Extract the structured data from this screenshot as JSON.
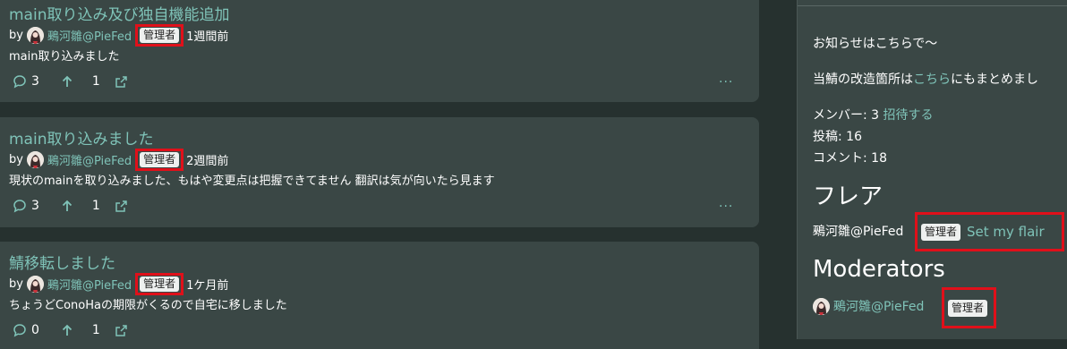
{
  "posts": [
    {
      "title": "main取り込み及び独自機能追加",
      "by": "by",
      "author": "鵐河雛@PieFed",
      "flair": "管理者",
      "time": "1週間前",
      "body": "main取り込みました",
      "comments": "3",
      "votes": "1"
    },
    {
      "title": "main取り込みました",
      "by": "by",
      "author": "鵐河雛@PieFed",
      "flair": "管理者",
      "time": "2週間前",
      "body": "現状のmainを取り込みました、もはや変更点は把握できてません 翻訳は気が向いたら見ます",
      "comments": "3",
      "votes": "1"
    },
    {
      "title": "鯖移転しました",
      "by": "by",
      "author": "鵐河雛@PieFed",
      "flair": "管理者",
      "time": "1ケ月前",
      "body": "ちょうどConoHaの期限がくるので自宅に移しました",
      "comments": "0",
      "votes": "1"
    }
  ],
  "sidebar": {
    "notice": "お知らせはこちらで〜",
    "modified_prefix": "当鯖の改造箇所は",
    "modified_link": "こちら",
    "modified_suffix": "にもまとめまし",
    "members_label": "メンバー: 3",
    "invite_link": "招待する",
    "posts_label": "投稿: 16",
    "comments_label": "コメント: 18",
    "flair_heading": "フレア",
    "flair_user": "鵐河雛@PieFed",
    "flair_badge": "管理者",
    "set_flair": "Set my flair",
    "moderators_heading": "Moderators",
    "moderator_name": "鵐河雛@PieFed",
    "moderator_badge": "管理者"
  },
  "colors": {
    "accent": "#7fc3b8",
    "highlight": "#e0101a",
    "card": "#3a4745",
    "page": "#26312f"
  }
}
